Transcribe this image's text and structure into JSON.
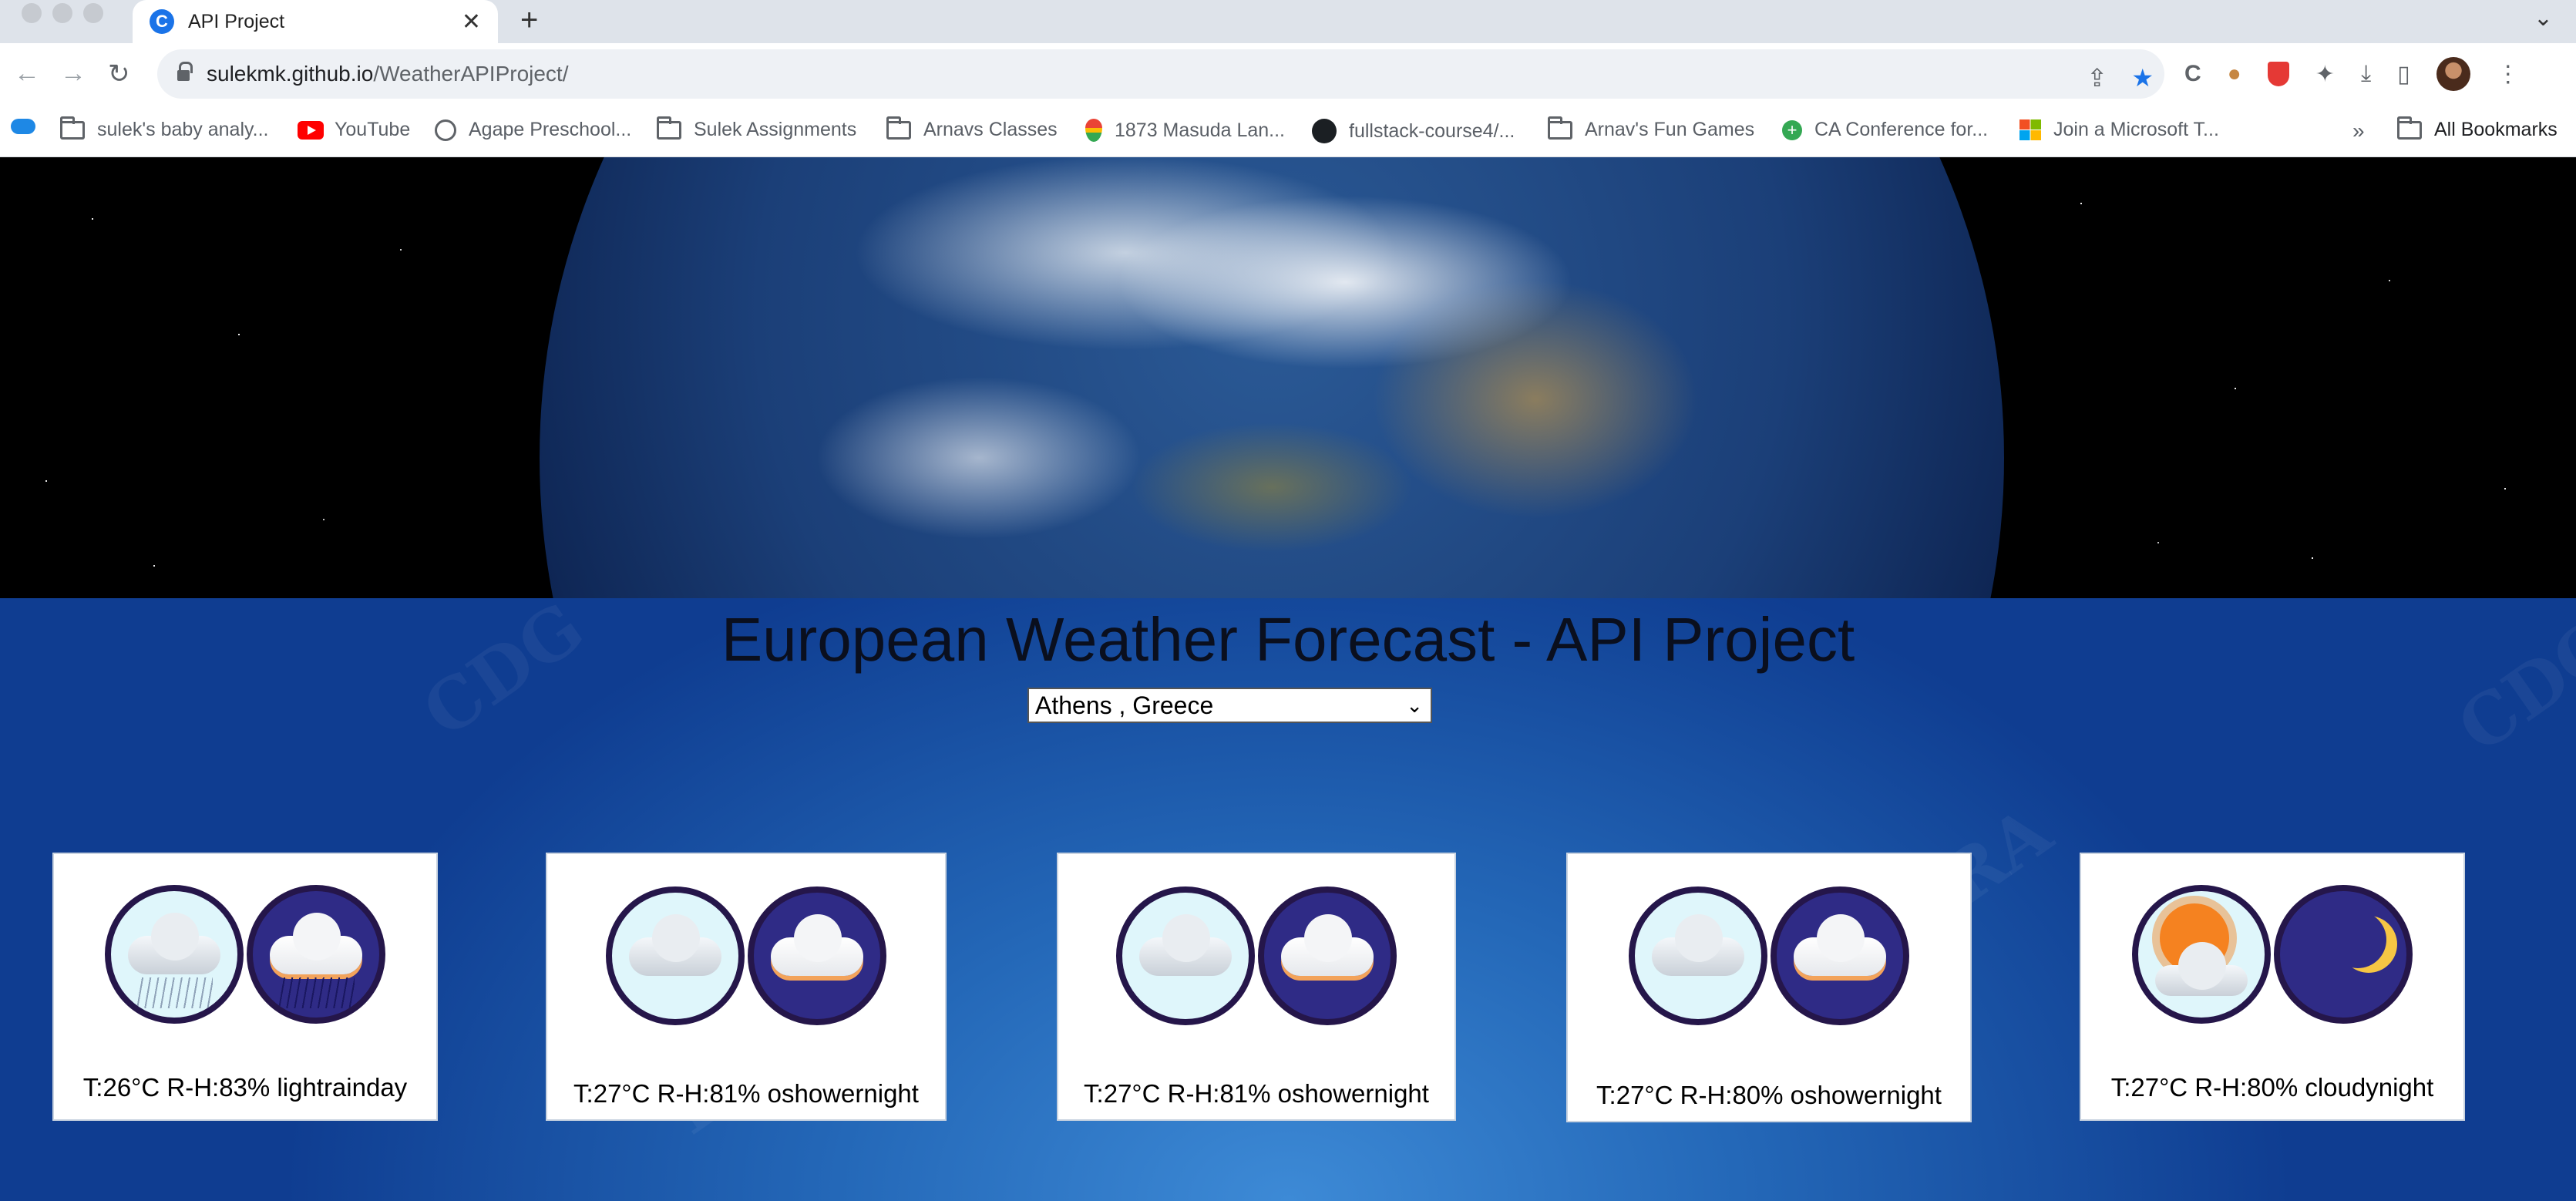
{
  "browser": {
    "tab": {
      "favicon_letter": "C",
      "title": "API Project"
    },
    "url": {
      "host": "sulekmk.github.io",
      "path": "/WeatherAPIProject/"
    },
    "bookmarks": [
      "sulek's baby analy...",
      "YouTube",
      "Agape Preschool...",
      "Sulek Assignments",
      "Arnavs Classes",
      "1873 Masuda Lan...",
      "fullstack-course4/...",
      "Arnav's Fun Games",
      "CA Conference for...",
      "Join a Microsoft T..."
    ],
    "overflow": "»",
    "all_bookmarks": "All Bookmarks"
  },
  "page": {
    "title": "European Weather Forecast - API Project",
    "selected_city": "Athens , Greece",
    "forecasts": [
      {
        "text": "T:26°C R-H:83% lightrainday",
        "icon": "lightrain"
      },
      {
        "text": "T:27°C R-H:81% oshowernight",
        "icon": "cloudy"
      },
      {
        "text": "T:27°C R-H:81% oshowernight",
        "icon": "cloudy"
      },
      {
        "text": "T:27°C R-H:80% oshowernight",
        "icon": "cloudy"
      },
      {
        "text": "T:27°C R-H:80% cloudynight",
        "icon": "sunny-moon"
      }
    ]
  }
}
